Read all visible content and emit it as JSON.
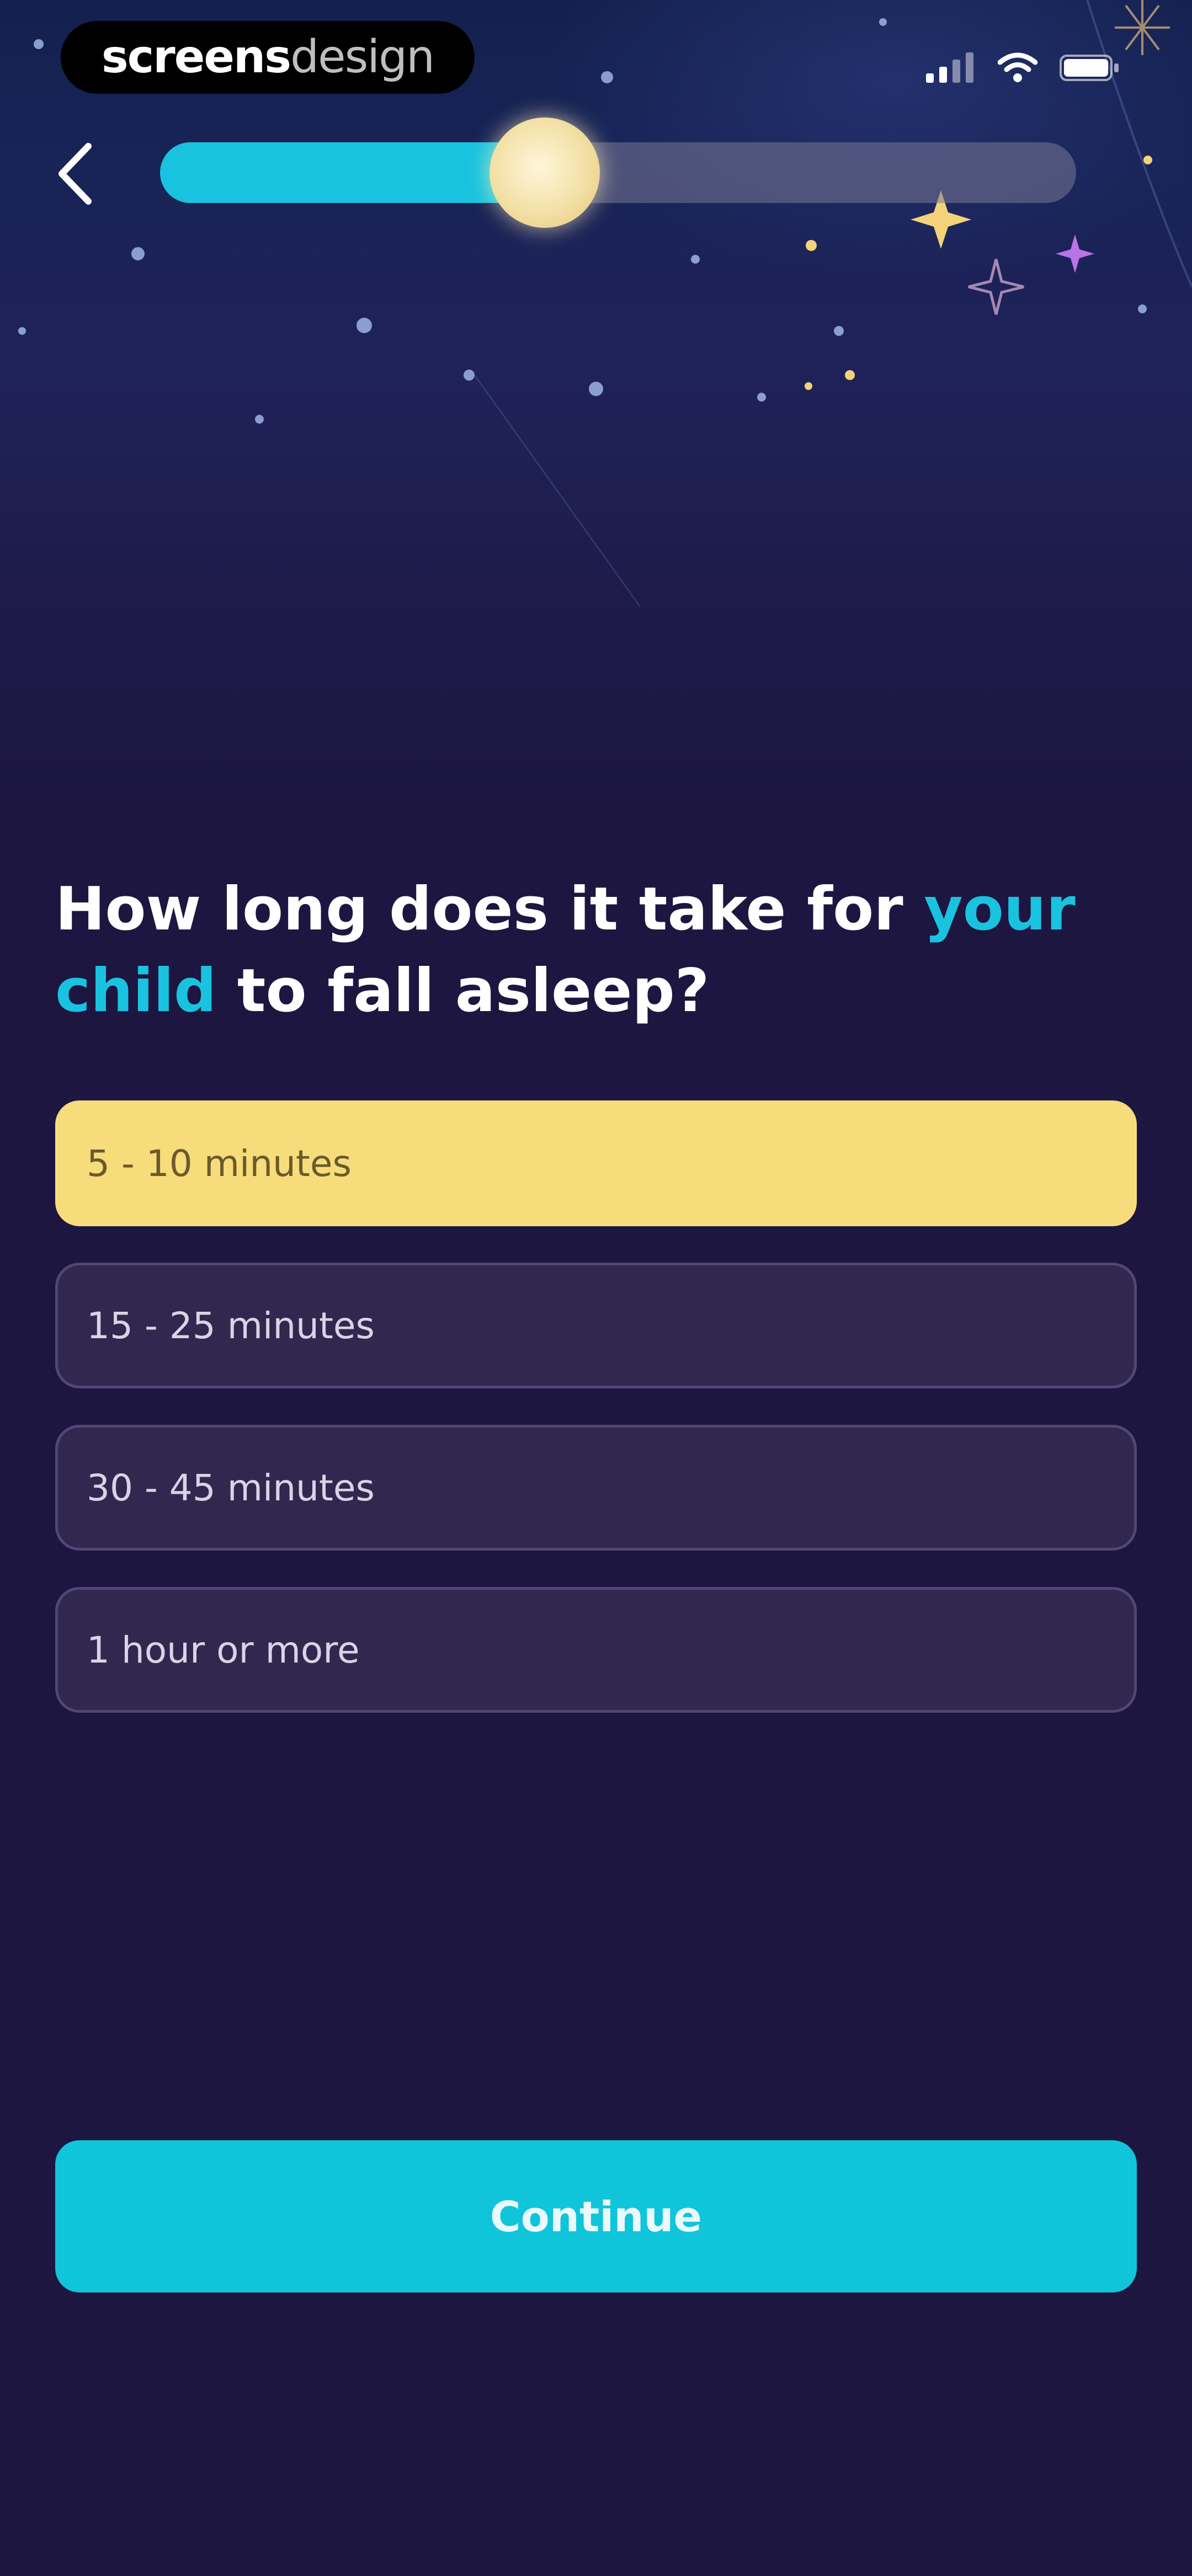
{
  "brand": {
    "text_bold": "screens",
    "text_light": "design"
  },
  "status_bar": {
    "icons": [
      "cellular-signal-icon",
      "wifi-icon",
      "battery-icon"
    ]
  },
  "nav": {
    "back_icon": "chevron-left-icon",
    "progress": {
      "value": 0.42,
      "indicator_icon": "moon-icon"
    }
  },
  "question": {
    "part1": "How long does it take for ",
    "highlight": "your child",
    "part2": " to fall asleep?"
  },
  "options": [
    {
      "label": "5 - 10 minutes",
      "selected": true
    },
    {
      "label": "15 - 25 minutes",
      "selected": false
    },
    {
      "label": "30 - 45 minutes",
      "selected": false
    },
    {
      "label": "1 hour or more",
      "selected": false
    }
  ],
  "continue_label": "Continue",
  "colors": {
    "background": "#1c1640",
    "accent": "#19c3df",
    "selected_option": "#f7dc7c",
    "option_bg": "#312850",
    "option_border": "#524774",
    "button": "#10c4da"
  }
}
